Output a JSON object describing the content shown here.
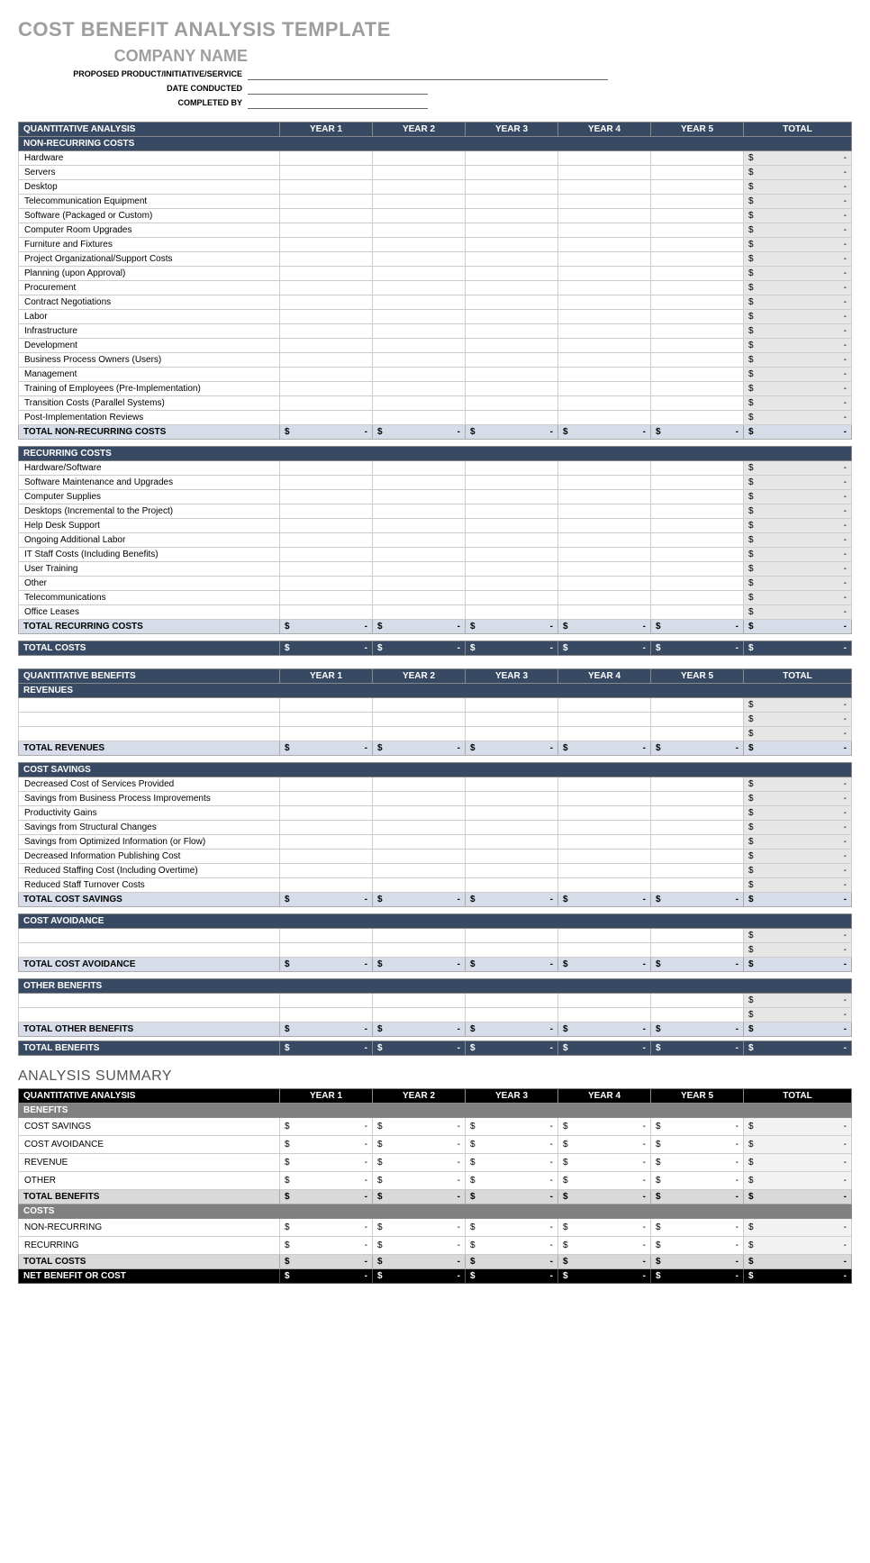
{
  "title": "COST BENEFIT ANALYSIS TEMPLATE",
  "company_name": "COMPANY NAME",
  "meta": {
    "product_label": "PROPOSED PRODUCT/INITIATIVE/SERVICE",
    "date_label": "DATE CONDUCTED",
    "completed_label": "COMPLETED BY"
  },
  "cols": {
    "analysis": "QUANTITATIVE ANALYSIS",
    "benefits": "QUANTITATIVE BENEFITS",
    "y1": "YEAR 1",
    "y2": "YEAR 2",
    "y3": "YEAR 3",
    "y4": "YEAR 4",
    "y5": "YEAR 5",
    "total": "TOTAL"
  },
  "money_symbol": "$",
  "money_dash": "-",
  "sections": {
    "nonrecurring": {
      "header": "NON-RECURRING COSTS",
      "subtotal": "TOTAL NON-RECURRING COSTS",
      "items": [
        "Hardware",
        "Servers",
        "Desktop",
        "Telecommunication Equipment",
        "Software (Packaged or Custom)",
        "Computer Room Upgrades",
        "Furniture and Fixtures",
        "Project Organizational/Support Costs",
        "Planning (upon Approval)",
        "Procurement",
        "Contract Negotiations",
        "Labor",
        "Infrastructure",
        "Development",
        "Business Process Owners (Users)",
        "Management",
        "Training of Employees (Pre-Implementation)",
        "Transition Costs (Parallel Systems)",
        "Post-Implementation Reviews"
      ]
    },
    "recurring": {
      "header": "RECURRING COSTS",
      "subtotal": "TOTAL RECURRING COSTS",
      "items": [
        "Hardware/Software",
        "Software Maintenance and Upgrades",
        "Computer Supplies",
        "Desktops (Incremental to the Project)",
        "Help Desk Support",
        "Ongoing Additional Labor",
        "IT Staff Costs (Including Benefits)",
        "User Training",
        "Other",
        "Telecommunications",
        "Office Leases"
      ]
    },
    "total_costs": "TOTAL COSTS",
    "revenues": {
      "header": "REVENUES",
      "subtotal": "TOTAL REVENUES",
      "blank_rows": 3
    },
    "cost_savings": {
      "header": "COST SAVINGS",
      "subtotal": "TOTAL COST SAVINGS",
      "items": [
        "Decreased Cost of Services Provided",
        "Savings from Business Process Improvements",
        "Productivity Gains",
        "Savings from Structural Changes",
        "Savings from Optimized Information (or Flow)",
        "Decreased Information Publishing Cost",
        "Reduced Staffing Cost (Including Overtime)",
        "Reduced Staff Turnover Costs"
      ]
    },
    "cost_avoidance": {
      "header": "COST AVOIDANCE",
      "subtotal": "TOTAL COST AVOIDANCE",
      "blank_rows": 2
    },
    "other_benefits": {
      "header": "OTHER BENEFITS",
      "subtotal": "TOTAL OTHER BENEFITS",
      "blank_rows": 2
    },
    "total_benefits": "TOTAL BENEFITS"
  },
  "summary": {
    "title": "ANALYSIS SUMMARY",
    "benefits_hdr": "BENEFITS",
    "costs_hdr": "COSTS",
    "benefit_rows": [
      "COST SAVINGS",
      "COST AVOIDANCE",
      "REVENUE",
      "OTHER"
    ],
    "total_benefits": "TOTAL BENEFITS",
    "cost_rows": [
      "NON-RECURRING",
      "RECURRING"
    ],
    "total_costs": "TOTAL COSTS",
    "net": "NET BENEFIT OR COST"
  }
}
